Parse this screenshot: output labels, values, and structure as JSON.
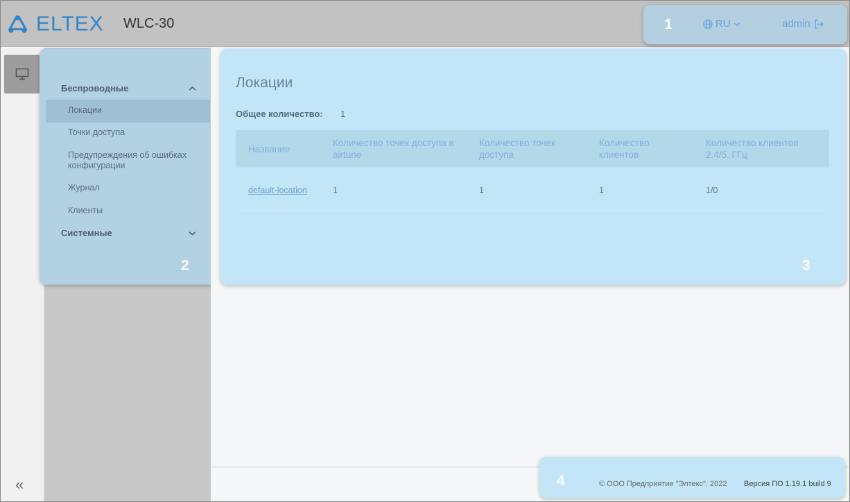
{
  "header": {
    "logo_text": "ELTEX",
    "model": "WLC-30",
    "language": "RU",
    "user": "admin"
  },
  "highlights": {
    "h1": "1",
    "h2": "2",
    "h3": "3",
    "h4": "4"
  },
  "sidebar": {
    "groups": [
      {
        "label": "Беспроводные",
        "expanded": true,
        "items": [
          {
            "label": "Локации",
            "active": true
          },
          {
            "label": "Точки доступа"
          },
          {
            "label": "Предупреждения об ошибках конфигурации"
          },
          {
            "label": "Журнал"
          },
          {
            "label": "Клиенты"
          }
        ]
      },
      {
        "label": "Системные",
        "expanded": false
      }
    ],
    "collapse_label": "«"
  },
  "main": {
    "title": "Локации",
    "total_label": "Общее количество:",
    "total_value": "1",
    "table": {
      "columns": [
        "Название",
        "Количество точек доступа в airtune",
        "Количество точек доступа",
        "Количество клиентов",
        "Количество клиентов 2.4/5, ГГц"
      ],
      "rows": [
        [
          "default-location",
          "1",
          "1",
          "1",
          "1/0"
        ]
      ]
    }
  },
  "footer": {
    "copyright": "© ООО Предприятие \"Элтекс\", 2022",
    "version": "Версия ПО 1.19.1 build 9"
  },
  "colors": {
    "brand": "#2f86c9",
    "highlight": "#c2e6f8",
    "link": "#6aa3df"
  }
}
